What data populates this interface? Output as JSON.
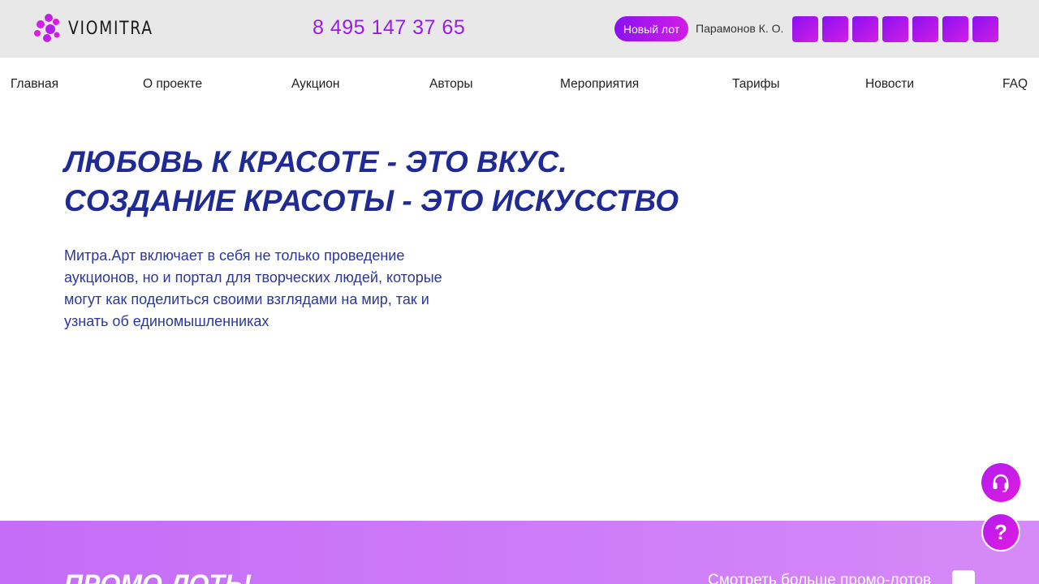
{
  "header": {
    "logo_text": "VIOMITRA",
    "phone": "8 495 147 37 65",
    "new_lot_label": "Новый лот",
    "user_name": "Парамонов К. О.",
    "social_icons": [
      "social-icon-1",
      "social-icon-2",
      "social-icon-3",
      "social-icon-4",
      "social-icon-5",
      "social-icon-6",
      "social-icon-7"
    ]
  },
  "nav": {
    "items": [
      {
        "label": "Главная"
      },
      {
        "label": "О проекте"
      },
      {
        "label": "Аукцион"
      },
      {
        "label": "Авторы"
      },
      {
        "label": "Мероприятия"
      },
      {
        "label": "Тарифы"
      },
      {
        "label": "Новости"
      },
      {
        "label": "FAQ"
      }
    ]
  },
  "hero": {
    "title_line1": "ЛЮБОВЬ К КРАСОТЕ - ЭТО ВКУС.",
    "title_line2": "СОЗДАНИЕ КРАСОТЫ - ЭТО ИСКУССТВО",
    "description": "Митра.Арт включает в себя не только проведение аукционов, но и портал для творческих людей, которые могут как поделиться своими взглядами на мир, так и узнать об единомышленниках"
  },
  "promo": {
    "title": "ПРОМО-ЛОТЫ",
    "more_label": "Смотреть больше промо-лотов"
  },
  "fabs": {
    "help_symbol": "?"
  },
  "colors": {
    "accent": "#9b1be6",
    "title_blue": "#1f2a94",
    "header_bg": "#e8e8e8"
  }
}
